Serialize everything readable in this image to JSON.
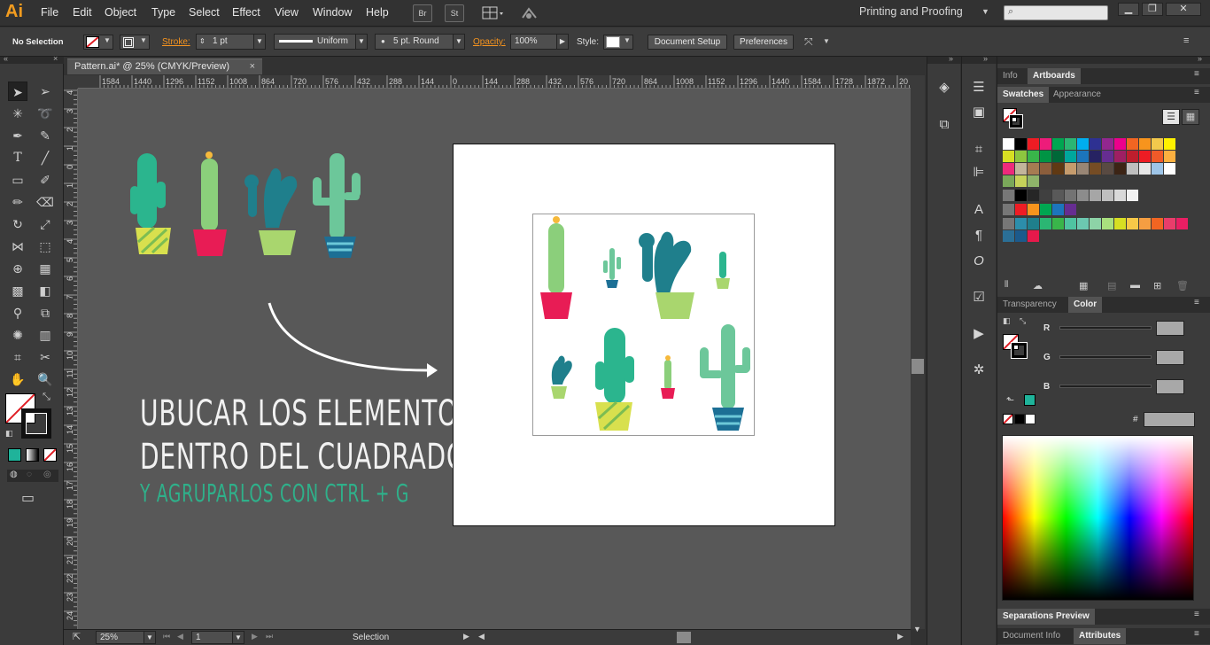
{
  "app": {
    "logo": "Ai"
  },
  "menu": [
    "File",
    "Edit",
    "Object",
    "Type",
    "Select",
    "Effect",
    "View",
    "Window",
    "Help"
  ],
  "menu_buttons": [
    "Br",
    "St"
  ],
  "workspace": {
    "label": "Printing and Proofing"
  },
  "control": {
    "selection": "No Selection",
    "stroke_label": "Stroke:",
    "stroke_weight": "1 pt",
    "profile": "Uniform",
    "brush": "5 pt. Round",
    "opacity_label": "Opacity:",
    "opacity": "100%",
    "style_label": "Style:",
    "document_setup": "Document Setup",
    "preferences": "Preferences"
  },
  "document": {
    "tab_title": "Pattern.ai* @ 25% (CMYK/Preview)"
  },
  "rulers": {
    "top": [
      "1584",
      "1440",
      "1296",
      "1152",
      "1008",
      "864",
      "720",
      "576",
      "432",
      "288",
      "144",
      "0",
      "144",
      "288",
      "432",
      "576",
      "720",
      "864",
      "1008",
      "1152",
      "1296",
      "1440",
      "1584",
      "1728",
      "1872",
      "20"
    ],
    "left": [
      "4",
      "3",
      "2",
      "1",
      "0",
      "1",
      "2",
      "3",
      "4",
      "5",
      "6",
      "7",
      "8",
      "9",
      "10",
      "11",
      "12",
      "13",
      "14",
      "15",
      "16",
      "17",
      "18",
      "19",
      "20",
      "21",
      "22",
      "23",
      "24",
      "25"
    ]
  },
  "caption": {
    "line1": "UBUCAR LOS ELEMENTOS",
    "line2": "DENTRO DEL CUADRADO",
    "line3": "Y AGRUPARLOS CON CTRL + G"
  },
  "status": {
    "zoom": "25%",
    "artboard": "1",
    "tool": "Selection"
  },
  "panels": {
    "top_tabs": [
      "Info",
      "Artboards"
    ],
    "swatch_tabs": [
      "Swatches",
      "Appearance"
    ],
    "color_tabs": [
      "Transparency",
      "Color"
    ],
    "color": {
      "r": "R",
      "g": "G",
      "b": "B",
      "hex": "#"
    },
    "bottom_tabs": [
      "Separations Preview"
    ],
    "bottom_tabs2": [
      "Document Info",
      "Attributes"
    ]
  },
  "swatch_rows": [
    [
      "#ffffff",
      "#000000",
      "#ee1c24",
      "#ed1c7a",
      "#00a651",
      "#2bb673",
      "#00aeef",
      "#2e3192",
      "#92278f",
      "#ec008c",
      "#f26522",
      "#f7941d",
      "#f2c94c",
      "#fff200"
    ],
    [
      "#d7df23",
      "#8dc63f",
      "#39b54a",
      "#009444",
      "#006838",
      "#00a79d",
      "#1c75bc",
      "#262262",
      "#662d91",
      "#9e1f63",
      "#be1e2d",
      "#ed1c24",
      "#f15a29",
      "#fbb040"
    ],
    [
      "#ee2a7b",
      "#c2b59b",
      "#a67c52",
      "#8b5e3c",
      "#603913",
      "#c69c6d",
      "#998675",
      "#754c24",
      "#594a42",
      "#3c2415",
      "#bfbfbf",
      "#e6e6e6",
      "#9ec5e8",
      "#ffffff"
    ],
    [
      "#7aa85a",
      "#c6d35a",
      "#8fb46a"
    ],
    [
      "#000000",
      "#262626",
      "#404040",
      "#595959",
      "#737373",
      "#8c8c8c",
      "#a6a6a6",
      "#bfbfbf",
      "#d9d9d9",
      "#f2f2f2"
    ],
    [
      "#ee1c24",
      "#f7941d",
      "#00a651",
      "#1c75bc",
      "#662d91"
    ],
    [
      "#2c8eab",
      "#1f7f8c",
      "#2bb673",
      "#39b54a",
      "#4fc3a1",
      "#6cc8b0",
      "#8dd3a7",
      "#a9e07e",
      "#d7df23",
      "#f7c948",
      "#f59e42",
      "#f26522",
      "#e93d6b",
      "#e91e63"
    ],
    [
      "#2b6f96",
      "#1c5a8c",
      "#e6194b"
    ]
  ],
  "colors": {
    "fill_swatch": "#1fb39a",
    "accent_green": "#2fb08a"
  }
}
